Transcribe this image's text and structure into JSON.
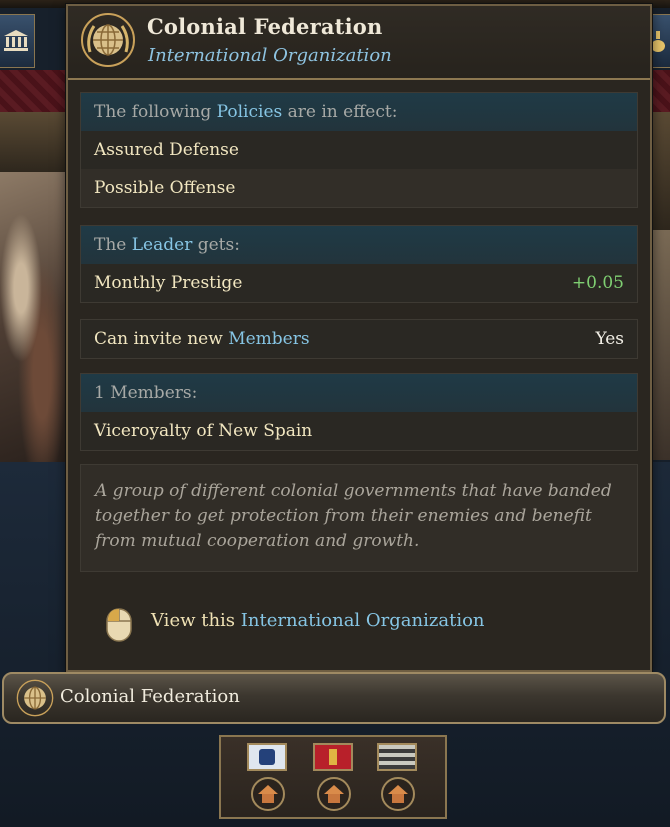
{
  "tooltip": {
    "title": "Colonial Federation",
    "subtitle": "International Organization",
    "policies": {
      "head_prefix": "The following ",
      "head_link": "Policies",
      "head_suffix": " are in effect:",
      "items": [
        "Assured Defense",
        "Possible Offense"
      ]
    },
    "leader": {
      "head_prefix": "The ",
      "head_link": "Leader",
      "head_suffix": " gets:",
      "effect_label": "Monthly Prestige",
      "effect_value": "+0.05"
    },
    "invite": {
      "label_prefix": "Can invite new ",
      "label_link": "Members",
      "value": "Yes"
    },
    "members": {
      "head": "1 Members:",
      "items": [
        "Viceroyalty of New Spain"
      ]
    },
    "description": "A group of different colonial governments that have banded together to get protection from their enemies and benefit from mutual cooperation and growth.",
    "action": {
      "prefix": "View this ",
      "link": "International Organization",
      "icon": "mouse-left-click-icon"
    }
  },
  "bar": {
    "label": "Colonial Federation",
    "icon": "globe-laurel-emblem"
  },
  "member_flags": [
    {
      "icon": "blue-flag-lion-icon",
      "color": "#cfd8e6"
    },
    {
      "icon": "red-flag-cross-icon",
      "color": "#b8202a"
    },
    {
      "icon": "striped-flag-icon",
      "color": "#c9c9c0"
    }
  ],
  "colors": {
    "accent_blue": "#86c5e4",
    "positive_green": "#7fcf72",
    "gold_border": "#8d7851"
  }
}
